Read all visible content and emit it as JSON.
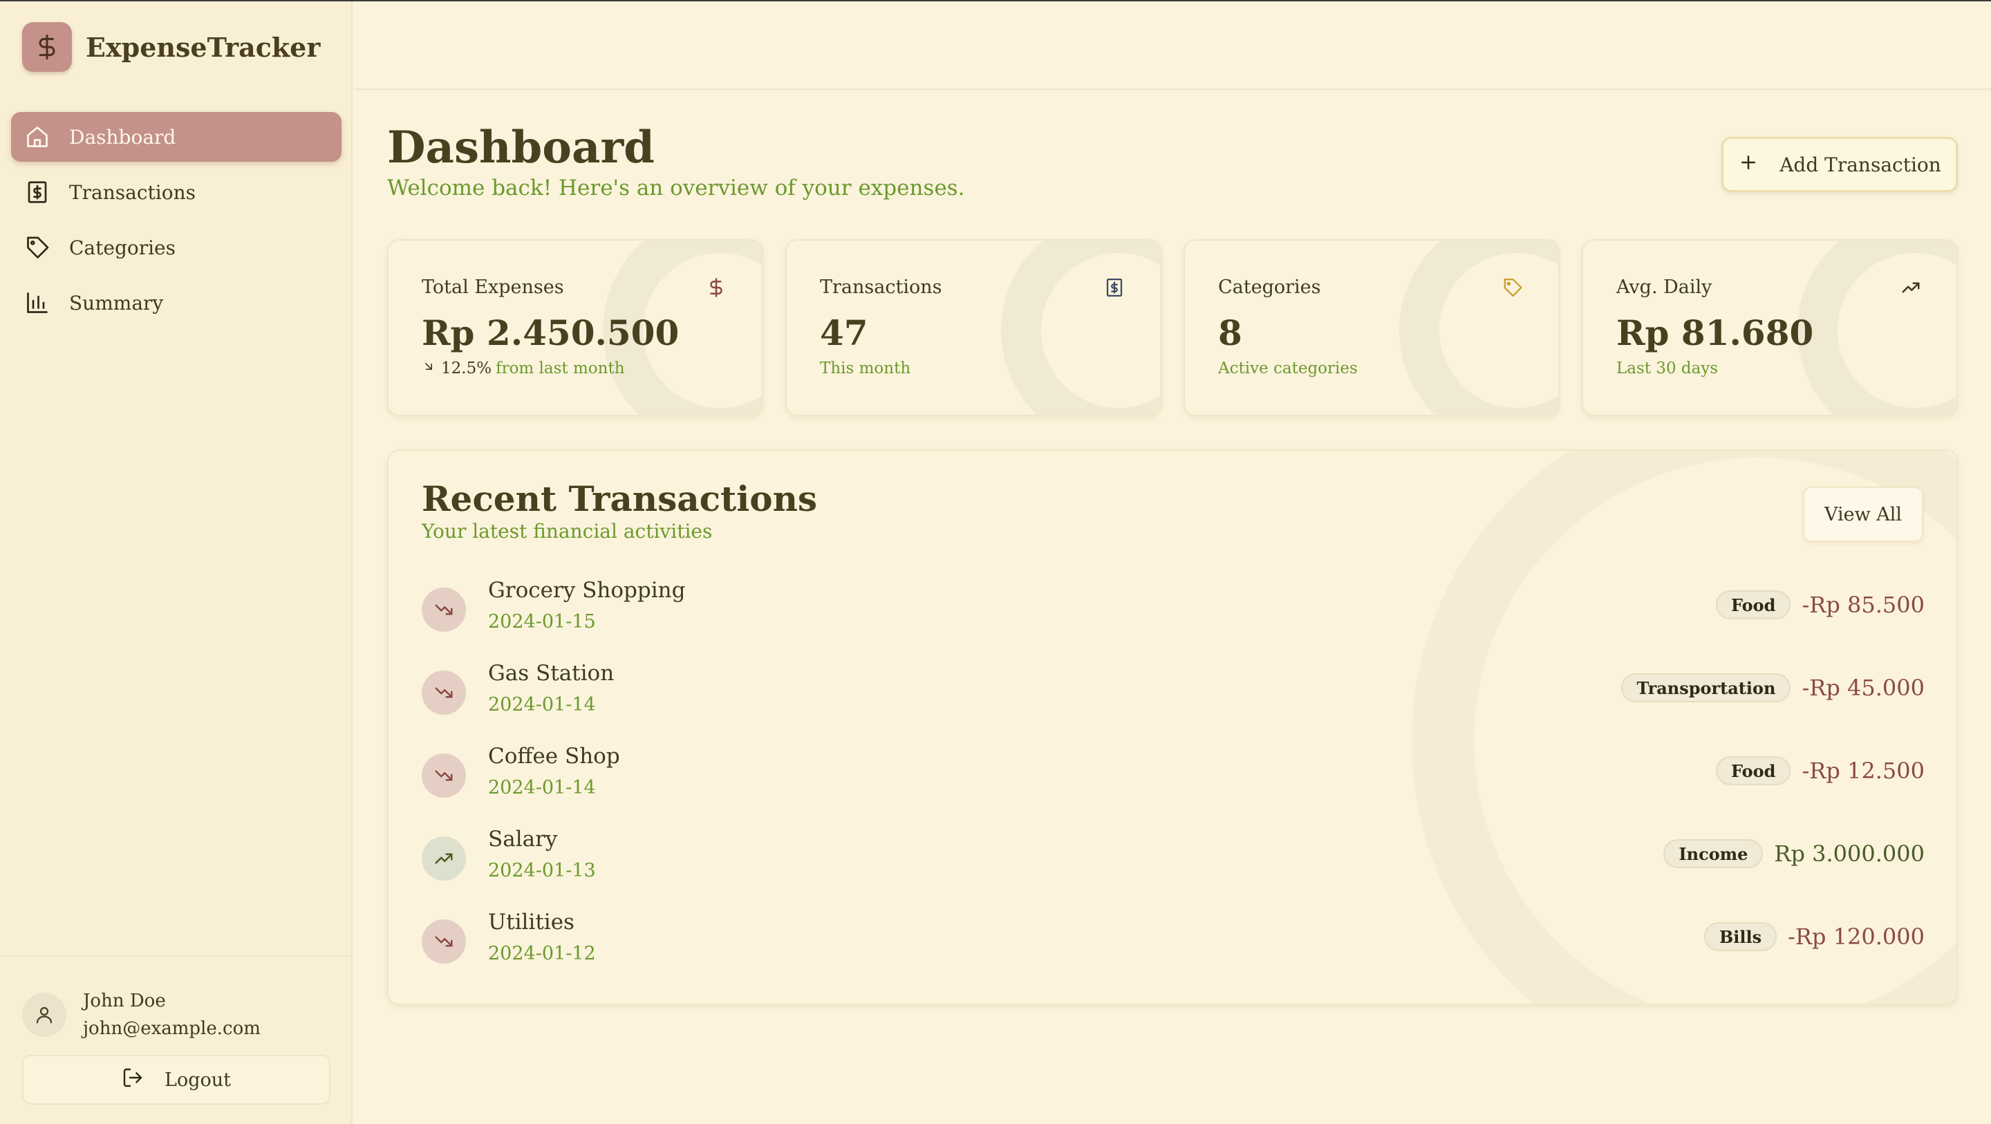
{
  "app": {
    "name": "ExpenseTracker"
  },
  "sidebar": {
    "items": [
      {
        "label": "Dashboard",
        "icon": "home-icon",
        "active": true
      },
      {
        "label": "Transactions",
        "icon": "receipt-icon",
        "active": false
      },
      {
        "label": "Categories",
        "icon": "tag-icon",
        "active": false
      },
      {
        "label": "Summary",
        "icon": "bar-chart-icon",
        "active": false
      }
    ],
    "user": {
      "name": "John Doe",
      "email": "john@example.com"
    },
    "logout_label": "Logout"
  },
  "header": {
    "title": "Dashboard",
    "subtitle": "Welcome back! Here's an overview of your expenses.",
    "add_button_label": "Add Transaction"
  },
  "stats": [
    {
      "label": "Total Expenses",
      "value": "Rp 2.450.500",
      "change": "12.5%",
      "note": "from last month",
      "icon": "dollar-icon"
    },
    {
      "label": "Transactions",
      "value": "47",
      "note": "This month",
      "icon": "receipt-icon"
    },
    {
      "label": "Categories",
      "value": "8",
      "note": "Active categories",
      "icon": "tag-icon"
    },
    {
      "label": "Avg. Daily",
      "value": "Rp 81.680",
      "note": "Last 30 days",
      "icon": "trending-up-icon"
    }
  ],
  "recent": {
    "title": "Recent Transactions",
    "subtitle": "Your latest financial activities",
    "view_all_label": "View All",
    "transactions": [
      {
        "name": "Grocery Shopping",
        "date": "2024-01-15",
        "category": "Food",
        "amount": "-Rp 85.500",
        "type": "expense"
      },
      {
        "name": "Gas Station",
        "date": "2024-01-14",
        "category": "Transportation",
        "amount": "-Rp 45.000",
        "type": "expense"
      },
      {
        "name": "Coffee Shop",
        "date": "2024-01-14",
        "category": "Food",
        "amount": "-Rp 12.500",
        "type": "expense"
      },
      {
        "name": "Salary",
        "date": "2024-01-13",
        "category": "Income",
        "amount": "Rp 3.000.000",
        "type": "income"
      },
      {
        "name": "Utilities",
        "date": "2024-01-12",
        "category": "Bills",
        "amount": "-Rp 120.000",
        "type": "expense"
      }
    ]
  },
  "colors": {
    "accent": "#c4928a",
    "background": "#fbf3dc",
    "positive_text": "#6a9a2e",
    "expense_amount": "#8a4a44"
  }
}
